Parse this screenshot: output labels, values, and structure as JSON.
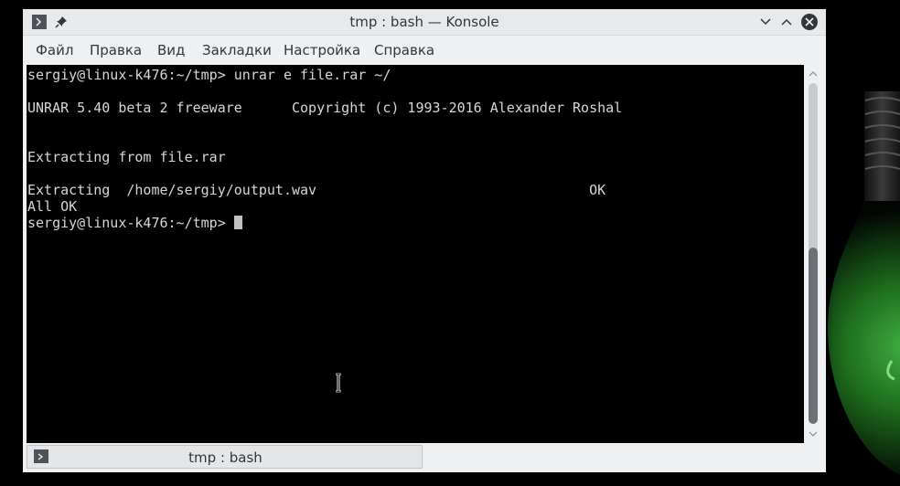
{
  "window": {
    "title": "tmp : bash — Konsole"
  },
  "menu": [
    {
      "label": "Файл"
    },
    {
      "label": "Правка"
    },
    {
      "label": "Вид"
    },
    {
      "label": "Закладки"
    },
    {
      "label": "Настройка"
    },
    {
      "label": "Справка"
    }
  ],
  "terminal": {
    "lines": [
      "sergiy@linux-k476:~/tmp> unrar e file.rar ~/",
      "",
      "UNRAR 5.40 beta 2 freeware      Copyright (c) 1993-2016 Alexander Roshal",
      "",
      "",
      "Extracting from file.rar",
      "",
      "Extracting  /home/sergiy/output.wav                                 OK",
      "All OK",
      "sergiy@linux-k476:~/tmp> "
    ]
  },
  "tabs": [
    {
      "label": "tmp : bash"
    }
  ],
  "colors": {
    "terminal_bg": "#000000",
    "terminal_fg": "#d6d6d6",
    "chrome": "#eff0f1",
    "text": "#31363b"
  },
  "icons": {
    "titlebar_left": [
      "konsole-app-icon",
      "pin-icon"
    ],
    "titlebar_right": [
      "minimize-icon",
      "maximize-icon",
      "close-icon"
    ],
    "tab": "terminal-icon"
  }
}
